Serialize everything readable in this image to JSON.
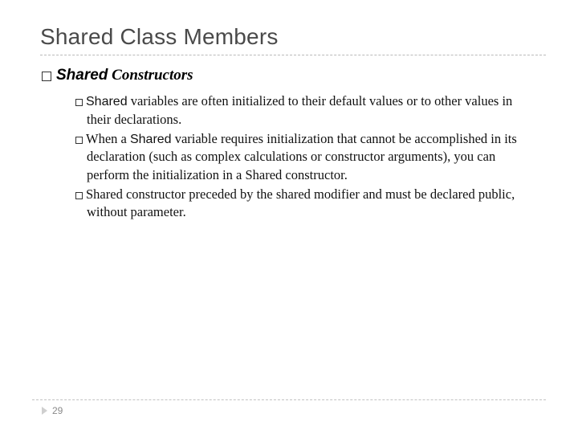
{
  "title": "Shared Class Members",
  "level1": {
    "kw": "Shared",
    "rest": " Constructors"
  },
  "bullets": [
    {
      "kw": "Shared",
      "text": " variables are often initialized to their default values or to other values in their declarations."
    },
    {
      "pre": "When a ",
      "kw": "Shared",
      "text": " variable requires initialization that cannot be accomplished in its declaration (such as complex calculations or constructor arguments), you can perform the initialization in a Shared constructor."
    },
    {
      "text": "Shared constructor preceded by the shared modifier and must be declared public, without parameter."
    }
  ],
  "page": "29"
}
